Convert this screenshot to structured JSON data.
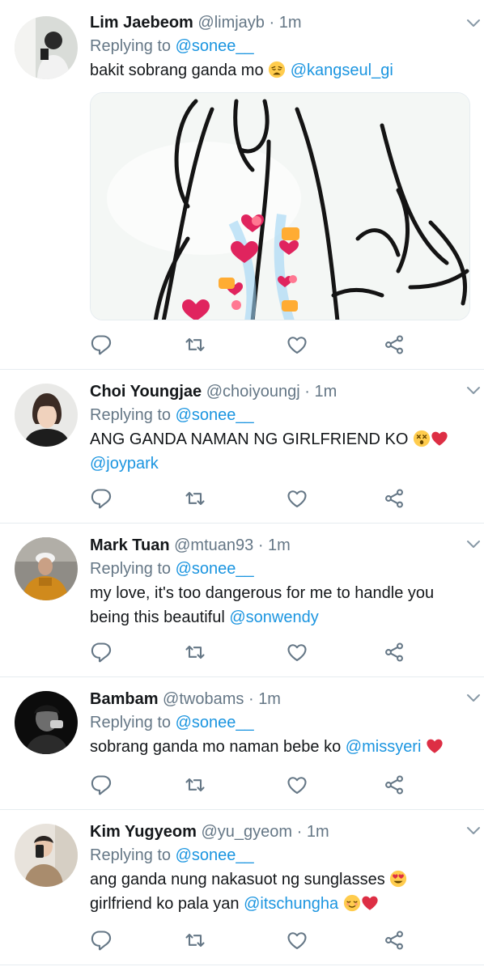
{
  "tweets": [
    {
      "name": "Lim Jaebeom",
      "handle": "@limjayb",
      "time": "1m",
      "reply_prefix": "Replying to",
      "reply_to": "@sonee__",
      "text_lines": [
        {
          "text": "bakit sobrang ganda mo ",
          "emoji1": "weary-face-emoji",
          "mention": "@kangseul_gi",
          "emoji2": ""
        }
      ],
      "has_media": true
    },
    {
      "name": "Choi Youngjae",
      "handle": "@choiyoungj",
      "time": "1m",
      "reply_prefix": "Replying to",
      "reply_to": "@sonee__",
      "text_lines": [
        {
          "text": "ANG GANDA NAMAN NG GIRLFRIEND KO ",
          "emoji1": "dizzy-face-emoji",
          "mention": "",
          "emoji2": "red-heart-emoji"
        },
        {
          "text": "",
          "emoji1": "",
          "mention": "@joypark",
          "emoji2": ""
        }
      ],
      "has_media": false
    },
    {
      "name": "Mark Tuan",
      "handle": "@mtuan93",
      "time": "1m",
      "reply_prefix": "Replying to",
      "reply_to": "@sonee__",
      "text_lines": [
        {
          "text": "my love, it's too dangerous for me to handle you",
          "emoji1": "",
          "mention": "",
          "emoji2": ""
        },
        {
          "text": "being this beautiful ",
          "emoji1": "",
          "mention": "@sonwendy",
          "emoji2": ""
        }
      ],
      "has_media": false
    },
    {
      "name": "Bambam",
      "handle": "@twobams",
      "time": "1m",
      "reply_prefix": "Replying to",
      "reply_to": "@sonee__",
      "text_lines": [
        {
          "text": "sobrang ganda mo naman bebe ko ",
          "emoji1": "",
          "mention": "@missyeri",
          "emoji2": "red-heart-emoji"
        }
      ],
      "has_media": false
    },
    {
      "name": "Kim Yugyeom",
      "handle": "@yu_gyeom",
      "time": "1m",
      "reply_prefix": "Replying to",
      "reply_to": "@sonee__",
      "text_lines": [
        {
          "text": "ang ganda nung nakasuot ng sunglasses ",
          "emoji1": "heart-eyes-emoji",
          "mention": "",
          "emoji2": ""
        },
        {
          "text": "girlfriend ko pala yan ",
          "emoji1": "",
          "mention": "@itschungha",
          "emoji2": "relieved-face-emoji",
          "emoji3": "red-heart-emoji"
        }
      ],
      "has_media": false
    }
  ],
  "colors": {
    "mention": "#1b95e0",
    "secondary_text": "#657786",
    "icon": "#657786",
    "divider": "#e6ecf0",
    "heart": "#e0245e"
  },
  "action_icons": [
    "reply-icon",
    "retweet-icon",
    "like-icon",
    "share-icon"
  ]
}
